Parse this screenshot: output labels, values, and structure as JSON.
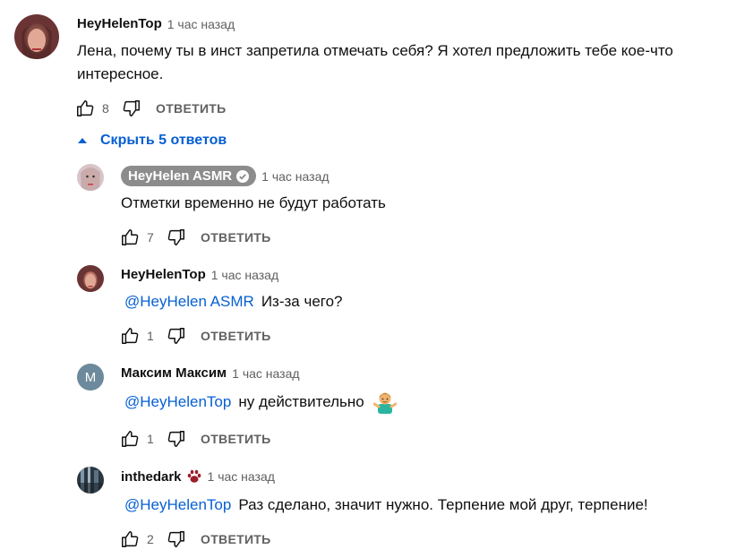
{
  "colors": {
    "link": "#065fd4",
    "muted": "#606060",
    "text": "#0f0f0f",
    "chip": "#8c8c8c",
    "letter_avatar": "#6c8a9b"
  },
  "top_comment": {
    "author": "HeyHelenTop",
    "time": "1 час назад",
    "text_line1": "Лена, почему ты в инст запретила отмечать себя? Я хотел предложить тебе кое-что",
    "text_line2": "интересное.",
    "likes": "8",
    "reply_label": "ОТВЕТИТЬ"
  },
  "toggle_replies": {
    "label": "Скрыть 5 ответов",
    "icon": "caret-up-icon"
  },
  "replies": [
    {
      "author": "HeyHelen ASMR",
      "verified": true,
      "time": "1 час назад",
      "mention": "",
      "text": "Отметки временно не будут работать",
      "likes": "7",
      "reply_label": "ОТВЕТИТЬ"
    },
    {
      "author": "HeyHelenTop",
      "time": "1 час назад",
      "mention": "@HeyHelen ASMR",
      "text": "Из-за чего?",
      "likes": "1",
      "reply_label": "ОТВЕТИТЬ"
    },
    {
      "author": "Максим Максим",
      "avatar_letter": "М",
      "time": "1 час назад",
      "mention": "@HeyHelenTop",
      "text": "ну действительно",
      "emoji": "man-shrugging-emoji",
      "likes": "1",
      "reply_label": "ОТВЕТИТЬ"
    },
    {
      "author": "inthedark",
      "badge": "paw-icon",
      "time": "1 час назад",
      "mention": "@HeyHelenTop",
      "text": "Раз сделано, значит нужно. Терпение мой друг, терпение!",
      "likes": "2",
      "reply_label": "ОТВЕТИТЬ"
    }
  ]
}
